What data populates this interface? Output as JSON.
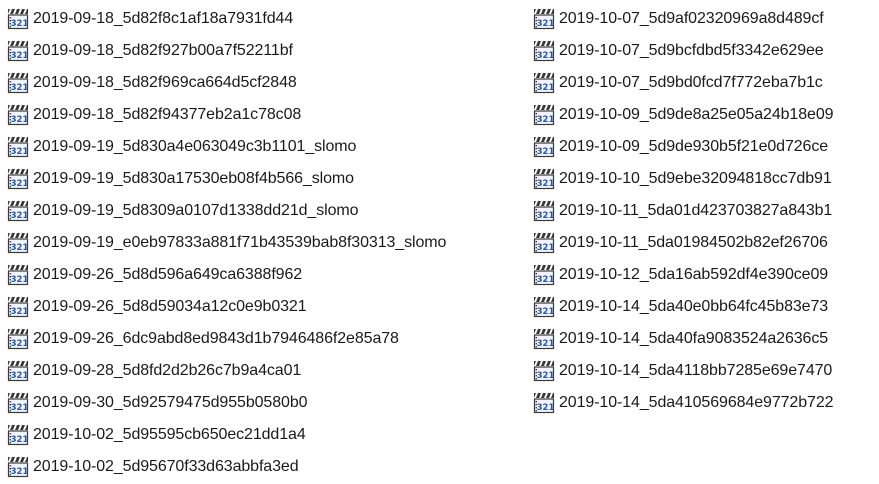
{
  "file_icon": "media-player-classic-321-icon",
  "colors": {
    "text": "#1a1a1a",
    "background": "#ffffff",
    "icon_clapper": "#3a3a3a",
    "icon_digits": "#1e5aa8"
  },
  "icon_glyph": "321",
  "files_left": [
    "2019-09-18_5d82f8c1af18a7931fd44",
    "2019-09-18_5d82f927b00a7f52211bf",
    "2019-09-18_5d82f969ca664d5cf2848",
    "2019-09-18_5d82f94377eb2a1c78c08",
    "2019-09-19_5d830a4e063049c3b1101_slomo",
    "2019-09-19_5d830a17530eb08f4b566_slomo",
    "2019-09-19_5d8309a0107d1338dd21d_slomo",
    "2019-09-19_e0eb97833a881f71b43539bab8f30313_slomo",
    "2019-09-26_5d8d596a649ca6388f962",
    "2019-09-26_5d8d59034a12c0e9b0321",
    "2019-09-26_6dc9abd8ed9843d1b7946486f2e85a78",
    "2019-09-28_5d8fd2d2b26c7b9a4ca01",
    "2019-09-30_5d92579475d955b0580b0",
    "2019-10-02_5d95595cb650ec21dd1a4",
    "2019-10-02_5d95670f33d63abbfa3ed"
  ],
  "files_right": [
    "2019-10-07_5d9af02320969a8d489cf",
    "2019-10-07_5d9bcfdbd5f3342e629ee",
    "2019-10-07_5d9bd0fcd7f772eba7b1c",
    "2019-10-09_5d9de8a25e05a24b18e09",
    "2019-10-09_5d9de930b5f21e0d726ce",
    "2019-10-10_5d9ebe32094818cc7db91",
    "2019-10-11_5da01d423703827a843b1",
    "2019-10-11_5da01984502b82ef26706",
    "2019-10-12_5da16ab592df4e390ce09",
    "2019-10-14_5da40e0bb64fc45b83e73",
    "2019-10-14_5da40fa9083524a2636c5",
    "2019-10-14_5da4118bb7285e69e7470",
    "2019-10-14_5da410569684e9772b722"
  ]
}
